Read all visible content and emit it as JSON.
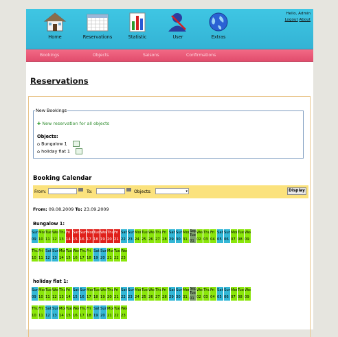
{
  "header": {
    "nav": [
      {
        "label": "Home",
        "icon": "house-icon"
      },
      {
        "label": "Reservations",
        "icon": "calendar-icon"
      },
      {
        "label": "Statistic",
        "icon": "bar-chart-icon"
      },
      {
        "label": "User",
        "icon": "user-icon"
      },
      {
        "label": "Extras",
        "icon": "globe-icon"
      }
    ],
    "greeting": "Hello, Admin",
    "logout": "Logout",
    "about": "About"
  },
  "subnav": [
    "Bookings",
    "Objects",
    "Saisons",
    "Confirmations"
  ],
  "page_title": "Reservations",
  "new_bookings": {
    "legend": "New Bookings",
    "new_link": "New reservation for all objects",
    "objects_label": "Objects:",
    "objects": [
      "Bungalow 1",
      "holiday flat 1"
    ]
  },
  "calendar": {
    "title": "Booking Calendar",
    "from_label": "From:",
    "to_label": "To:",
    "objects_label": "Objects:",
    "display_button": "Display",
    "range_from_label": "From:",
    "range_from": "09.08.2009",
    "range_to_label": "To:",
    "range_to": "23.09.2009",
    "objects": [
      {
        "name": "Bungalow 1:",
        "rows": [
          [
            "Sun|09|we",
            "Mon|10|free",
            "Tue|11|free",
            "Wed|12|free",
            "Thu|13|free",
            "Fri|14|booked",
            "Sat|15|booked",
            "Sun|16|booked",
            "Mon|17|booked",
            "Tue|18|booked",
            "Wed|19|booked",
            "Thu|20|booked",
            "Fri|21|booked",
            "Sat|22|we",
            "Sun|23|we",
            "Mon|24|free",
            "Tue|25|free",
            "Wed|26|free",
            "Thu|27|free",
            "Fri|28|free",
            "Sat|29|we",
            "Sun|30|we",
            "Mon|31|free",
            "Sep Tue|01|today",
            "Wed|02|free",
            "Thu|03|free",
            "Fri|04|free",
            "Sat|05|we",
            "Sun|06|we",
            "Mon|07|free",
            "Tue|08|free",
            "Wed|09|free"
          ],
          [
            "Thu|10|free",
            "Fri|11|free",
            "Sat|12|we",
            "Sun|13|we",
            "Mon|14|free",
            "Tue|15|free",
            "Wed|16|free",
            "Thu|17|free",
            "Fri|18|free",
            "Sat|19|we",
            "Sun|20|we",
            "Mon|21|free",
            "Tue|22|free",
            "Wed|23|free"
          ]
        ]
      },
      {
        "name": "holiday flat 1:",
        "rows": [
          [
            "Sun|09|we",
            "Mon|10|free",
            "Tue|11|free",
            "Wed|12|free",
            "Thu|13|free",
            "Fri|14|free",
            "Sat|15|we",
            "Sun|16|we",
            "Mon|17|free",
            "Tue|18|free",
            "Wed|19|free",
            "Thu|20|free",
            "Fri|21|free",
            "Sat|22|we",
            "Sun|23|we",
            "Mon|24|free",
            "Tue|25|free",
            "Wed|26|free",
            "Thu|27|free",
            "Fri|28|free",
            "Sat|29|we",
            "Sun|30|we",
            "Mon|31|free",
            "Sep Tue|01|today",
            "Wed|02|free",
            "Thu|03|free",
            "Fri|04|free",
            "Sat|05|we",
            "Sun|06|we",
            "Mon|07|free",
            "Tue|08|free",
            "Wed|09|free"
          ],
          [
            "Thu|10|free",
            "Fri|11|free",
            "Sat|12|we",
            "Sun|13|we",
            "Mon|14|free",
            "Tue|15|free",
            "Wed|16|free",
            "Thu|17|free",
            "Fri|18|free",
            "Sat|19|we",
            "Sun|20|we",
            "Mon|21|free",
            "Tue|22|free",
            "Wed|23|free"
          ]
        ]
      }
    ]
  },
  "colors": {
    "free": "#8ae60a",
    "weekend": "#33b7d6",
    "booked": "#e0201a",
    "today": "#7c9d6e"
  }
}
